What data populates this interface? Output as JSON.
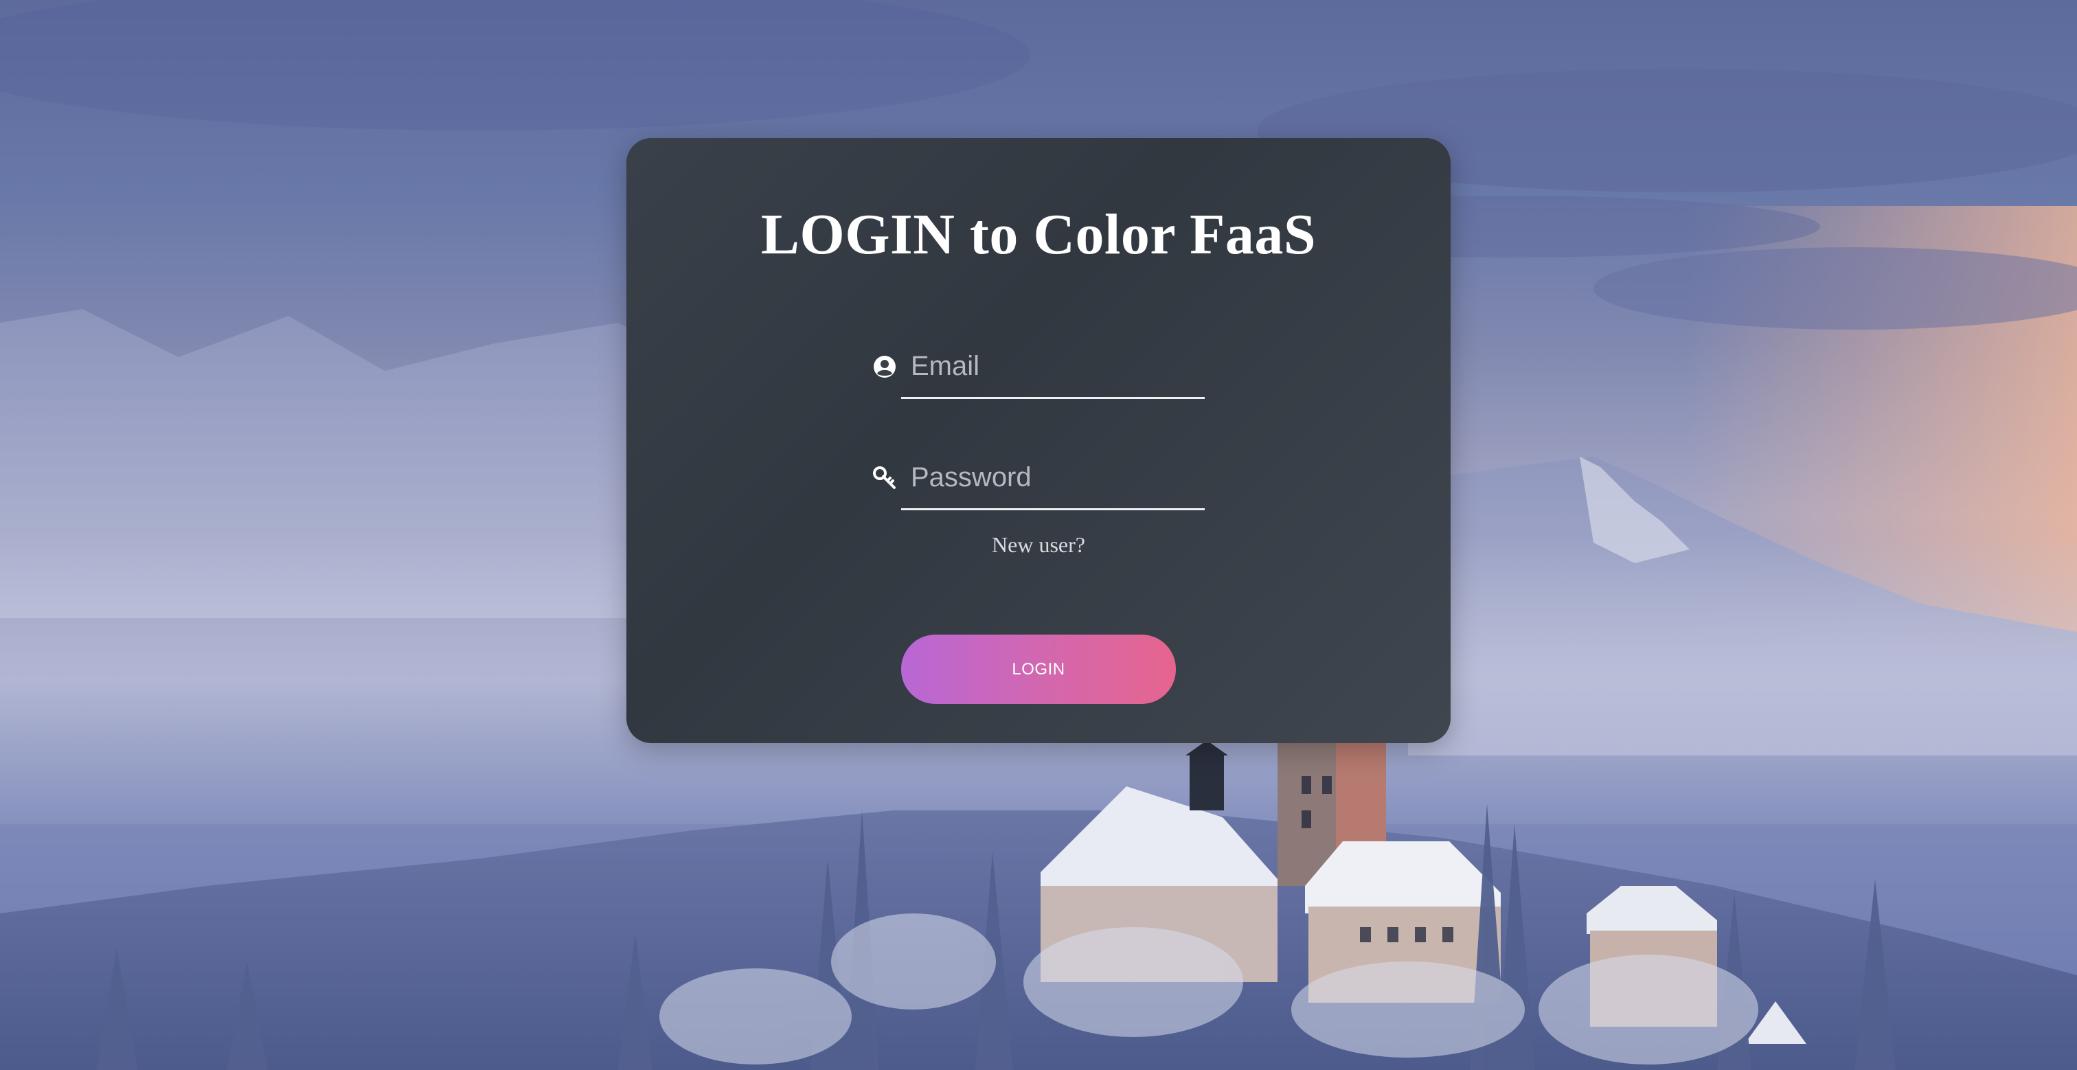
{
  "login": {
    "title": "LOGIN to Color FaaS",
    "email_placeholder": "Email",
    "password_placeholder": "Password",
    "new_user_link": "New user?",
    "button_label": "LOGIN"
  },
  "icons": {
    "email": "user-circle-icon",
    "password": "key-icon"
  },
  "colors": {
    "card_background": "#353b44",
    "button_gradient_start": "#b867d6",
    "button_gradient_end": "#e6658e",
    "text": "#ffffff"
  }
}
